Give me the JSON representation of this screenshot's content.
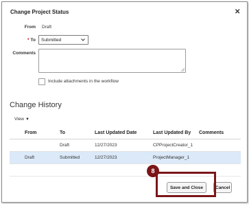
{
  "dialog": {
    "title": "Change Project Status",
    "close_icon": "close-icon"
  },
  "form": {
    "from_label": "From",
    "from_value": "Draft",
    "required_marker": "*",
    "to_label": "To",
    "to_value": "Submitted",
    "comments_label": "Comments",
    "comments_value": "",
    "include_attachments_label": "Include attachments in the workflow",
    "include_attachments_checked": false
  },
  "history": {
    "title": "Change History",
    "view_menu": "View",
    "columns": [
      "From",
      "To",
      "Last Updated Date",
      "Last Updated By",
      "Comments"
    ],
    "rows": [
      {
        "from": "",
        "to": "Draft",
        "date": "12/27/2023",
        "by": "CPProjectCreator_1",
        "comments": "",
        "selected": false
      },
      {
        "from": "Draft",
        "to": "Submitted",
        "date": "12/27/2023",
        "by": "ProjectManager_1",
        "comments": "",
        "selected": true
      }
    ]
  },
  "footer": {
    "save_label": "Save and Close",
    "cancel_label": "Cancel"
  },
  "annotation": {
    "step_number": "8",
    "color": "#7a1518"
  },
  "colors": {
    "selected_row": "#dbe9f8",
    "required": "#c00000"
  }
}
